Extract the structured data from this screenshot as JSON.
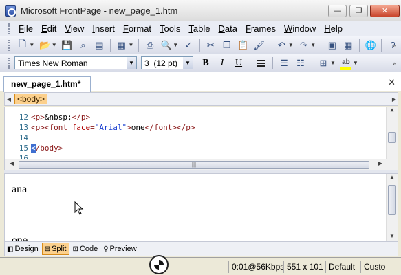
{
  "window": {
    "title": "Microsoft FrontPage - new_page_1.htm",
    "minimize_label": "—",
    "maximize_label": "❐",
    "close_label": "✕"
  },
  "menu": {
    "items": [
      {
        "key": "F",
        "rest": "ile"
      },
      {
        "key": "E",
        "rest": "dit"
      },
      {
        "key": "V",
        "rest": "iew"
      },
      {
        "key": "I",
        "rest": "nsert"
      },
      {
        "key": "F",
        "rest": "ormat",
        "prefix": ""
      },
      {
        "key": "T",
        "rest": "ools"
      },
      {
        "key": "T",
        "rest": "able"
      },
      {
        "key": "D",
        "rest": "ata"
      },
      {
        "key": "F",
        "rest": "rames"
      },
      {
        "key": "W",
        "rest": "indow"
      },
      {
        "key": "H",
        "rest": "elp"
      }
    ]
  },
  "format_toolbar": {
    "font_name": "Times New Roman",
    "font_size": "3  (12 pt)",
    "bold": "B",
    "italic": "I",
    "underline": "U",
    "highlight_label": "ab"
  },
  "document": {
    "tab_title": "new_page_1.htm*",
    "close_symbol": "✕",
    "quick_tag": "<body>"
  },
  "code": {
    "lines": [
      {
        "num": "12",
        "parts": [
          [
            "tg",
            "<p>"
          ],
          [
            "tx",
            "&nbsp;"
          ],
          [
            "tg",
            "</p>"
          ]
        ]
      },
      {
        "num": "13",
        "parts": [
          [
            "tg",
            "<p><font "
          ],
          [
            "at",
            "face"
          ],
          [
            "tg",
            "="
          ],
          [
            "av",
            "\"Arial\""
          ],
          [
            "tg",
            ">"
          ],
          [
            "tx",
            "one"
          ],
          [
            "tg",
            "</font></p>"
          ]
        ]
      },
      {
        "num": "14",
        "parts": []
      },
      {
        "num": "15",
        "parts": [
          [
            "sel",
            "<"
          ],
          [
            "tg",
            "/body>"
          ]
        ]
      },
      {
        "num": "16",
        "parts": []
      }
    ]
  },
  "design": {
    "paragraph1": "ana",
    "paragraph2": "one"
  },
  "views": {
    "design": "Design",
    "split": "Split",
    "code": "Code",
    "preview": "Preview"
  },
  "status": {
    "download_time": "0:01@56Kbps",
    "dimensions": "551 x 101",
    "mode": "Default",
    "custom": "Custo"
  }
}
